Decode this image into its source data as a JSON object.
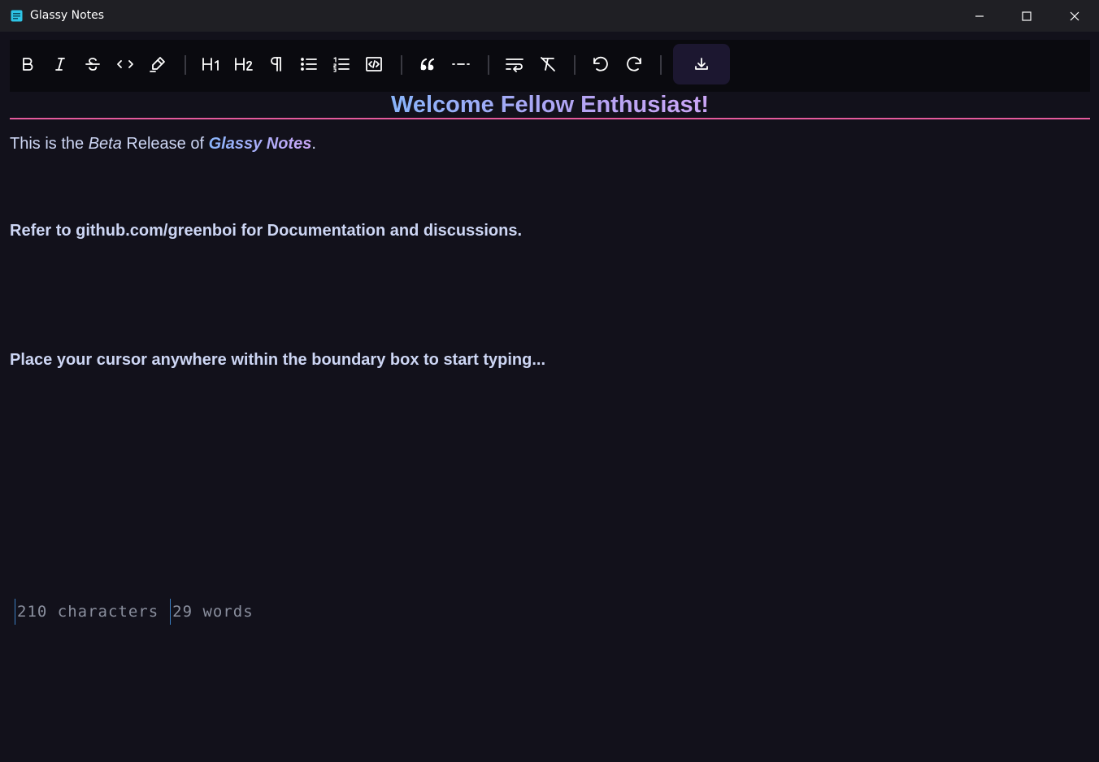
{
  "window": {
    "title": "Glassy Notes"
  },
  "toolbar": {
    "buttons": [
      {
        "name": "bold-button",
        "icon": "bold-icon"
      },
      {
        "name": "italic-button",
        "icon": "italic-icon"
      },
      {
        "name": "strikethrough-button",
        "icon": "strikethrough-icon"
      },
      {
        "name": "code-button",
        "icon": "code-icon"
      },
      {
        "name": "highlight-button",
        "icon": "highlighter-icon"
      },
      {
        "name": "heading1-button",
        "icon": "h1-icon"
      },
      {
        "name": "heading2-button",
        "icon": "h2-icon"
      },
      {
        "name": "paragraph-button",
        "icon": "pilcrow-icon"
      },
      {
        "name": "bullet-list-button",
        "icon": "bullet-list-icon"
      },
      {
        "name": "ordered-list-button",
        "icon": "ordered-list-icon"
      },
      {
        "name": "code-block-button",
        "icon": "code-block-icon"
      },
      {
        "name": "blockquote-button",
        "icon": "quote-icon"
      },
      {
        "name": "horizontal-rule-button",
        "icon": "horizontal-rule-icon"
      },
      {
        "name": "hard-break-button",
        "icon": "text-wrap-icon"
      },
      {
        "name": "clear-format-button",
        "icon": "clear-format-icon"
      },
      {
        "name": "undo-button",
        "icon": "undo-icon"
      },
      {
        "name": "redo-button",
        "icon": "redo-icon"
      },
      {
        "name": "download-button",
        "icon": "download-icon"
      }
    ],
    "h1_label": "H1",
    "h2_label": "H2"
  },
  "document": {
    "heading": "Welcome Fellow Enthusiast!",
    "intro": {
      "part1": "This is the ",
      "beta": "Beta",
      "part2": " Release of ",
      "brand": "Glassy Notes",
      "part3": "."
    },
    "refer": "Refer to github.com/greenboi for Documentation and discussions.",
    "cursor_hint": "Place your cursor anywhere within the boundary box to start typing..."
  },
  "status": {
    "characters": "210 characters",
    "words": "29 words"
  },
  "colors": {
    "background": "#12111b",
    "heading_rule": "#e45a9c",
    "heading_gradient_start": "#89b4fa",
    "heading_gradient_end": "#cba6f7",
    "status_divider": "#3c7fc2"
  }
}
